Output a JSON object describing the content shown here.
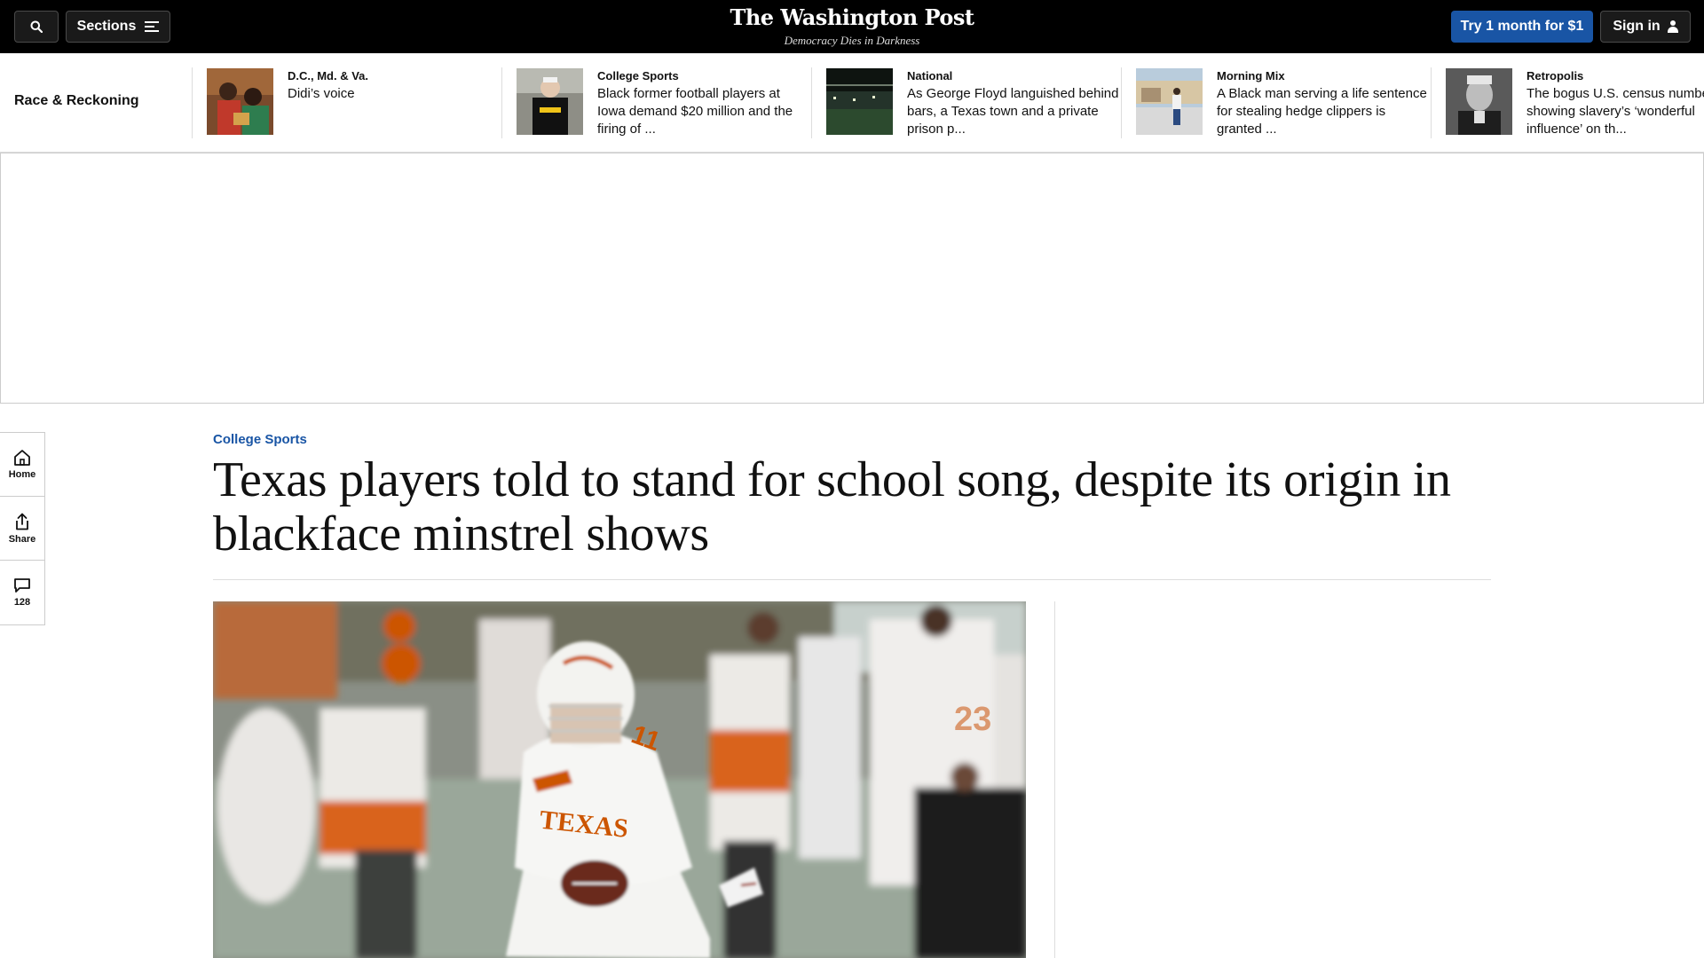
{
  "topbar": {
    "sections_label": "Sections",
    "logo": "The Washington Post",
    "tagline": "Democracy Dies in Darkness",
    "try_label": "Try 1 month for $1",
    "signin_label": "Sign in"
  },
  "strip": {
    "title": "Race & Reckoning",
    "items": [
      {
        "category": "D.C., Md. & Va.",
        "headline": "Didi’s voice"
      },
      {
        "category": "College Sports",
        "headline": "Black former football players at Iowa demand $20 million and the firing of ..."
      },
      {
        "category": "National",
        "headline": "As George Floyd languished behind bars, a Texas town and a private prison p..."
      },
      {
        "category": "Morning Mix",
        "headline": "A Black man serving a life sentence for stealing hedge clippers is granted ..."
      },
      {
        "category": "Retropolis",
        "headline": "The bogus U.S. census numbers showing slavery’s ‘wonderful influence’ on th..."
      }
    ]
  },
  "rail": {
    "home_label": "Home",
    "share_label": "Share",
    "comments_count": "128"
  },
  "article": {
    "kicker": "College Sports",
    "headline": "Texas players told to stand for school song, despite its origin in blackface minstrel shows"
  },
  "photo": {
    "jersey_text": "TEXAS",
    "jersey_number": "11",
    "background_number": "23"
  },
  "colors": {
    "accent_blue": "#1955a5",
    "topbar_bg": "#000000",
    "texas_orange": "#cc5500"
  }
}
